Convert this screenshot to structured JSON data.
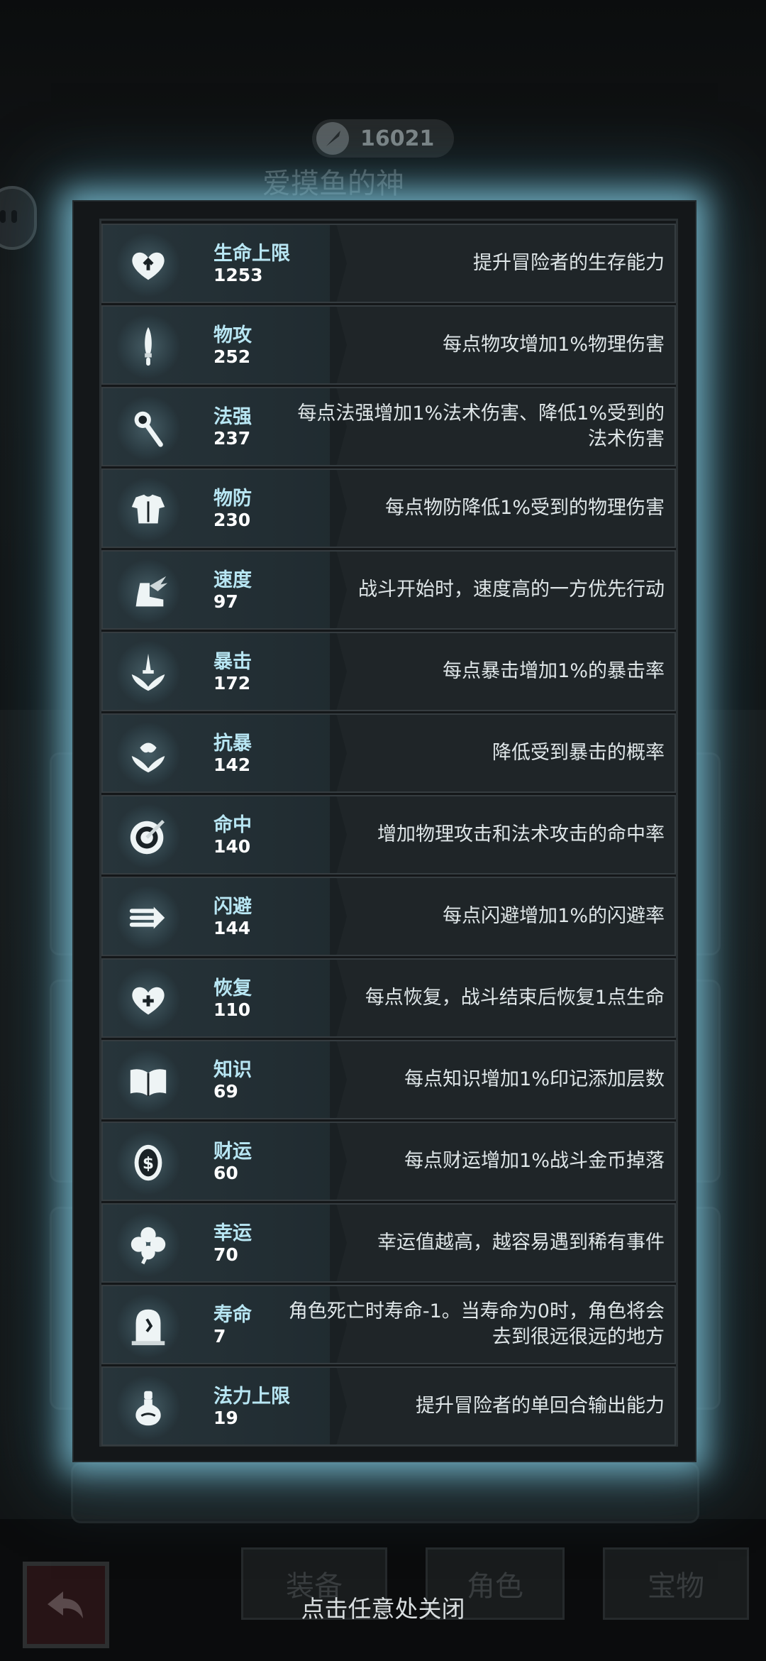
{
  "background": {
    "currency_amount": "16021",
    "hero_name": "爱摸鱼的神",
    "bottom_tabs": [
      "装备",
      "角色",
      "宝物"
    ]
  },
  "stats": [
    {
      "name": "生命上限",
      "value": "1253",
      "desc": "提升冒险者的生存能力",
      "icon": "heart-arrow-icon"
    },
    {
      "name": "物攻",
      "value": "252",
      "desc": "每点物攻增加1%物理伤害",
      "icon": "sword-icon"
    },
    {
      "name": "法强",
      "value": "237",
      "desc": "每点法强增加1%法术伤害、降低1%受到的法术伤害",
      "icon": "staff-icon"
    },
    {
      "name": "物防",
      "value": "230",
      "desc": "每点物防降低1%受到的物理伤害",
      "icon": "armor-icon"
    },
    {
      "name": "速度",
      "value": "97",
      "desc": "战斗开始时，速度高的一方优先行动",
      "icon": "winged-boot-icon"
    },
    {
      "name": "暴击",
      "value": "172",
      "desc": "每点暴击增加1%的暴击率",
      "icon": "crit-sword-icon"
    },
    {
      "name": "抗暴",
      "value": "142",
      "desc": "降低受到暴击的概率",
      "icon": "crit-resist-icon"
    },
    {
      "name": "命中",
      "value": "140",
      "desc": "增加物理攻击和法术攻击的命中率",
      "icon": "target-icon"
    },
    {
      "name": "闪避",
      "value": "144",
      "desc": "每点闪避增加1%的闪避率",
      "icon": "dodge-arrow-icon"
    },
    {
      "name": "恢复",
      "value": "110",
      "desc": "每点恢复，战斗结束后恢复1点生命",
      "icon": "heart-plus-icon"
    },
    {
      "name": "知识",
      "value": "69",
      "desc": "每点知识增加1%印记添加层数",
      "icon": "book-icon"
    },
    {
      "name": "财运",
      "value": "60",
      "desc": "每点财运增加1%战斗金币掉落",
      "icon": "coin-icon"
    },
    {
      "name": "幸运",
      "value": "70",
      "desc": "幸运值越高，越容易遇到稀有事件",
      "icon": "clover-icon"
    },
    {
      "name": "寿命",
      "value": "7",
      "desc": "角色死亡时寿命-1。当寿命为0时，角色将会去到很远很远的地方",
      "icon": "tombstone-icon"
    },
    {
      "name": "法力上限",
      "value": "19",
      "desc": "提升冒险者的单回合输出能力",
      "icon": "mana-flask-icon"
    }
  ],
  "close_hint": "点击任意处关闭"
}
